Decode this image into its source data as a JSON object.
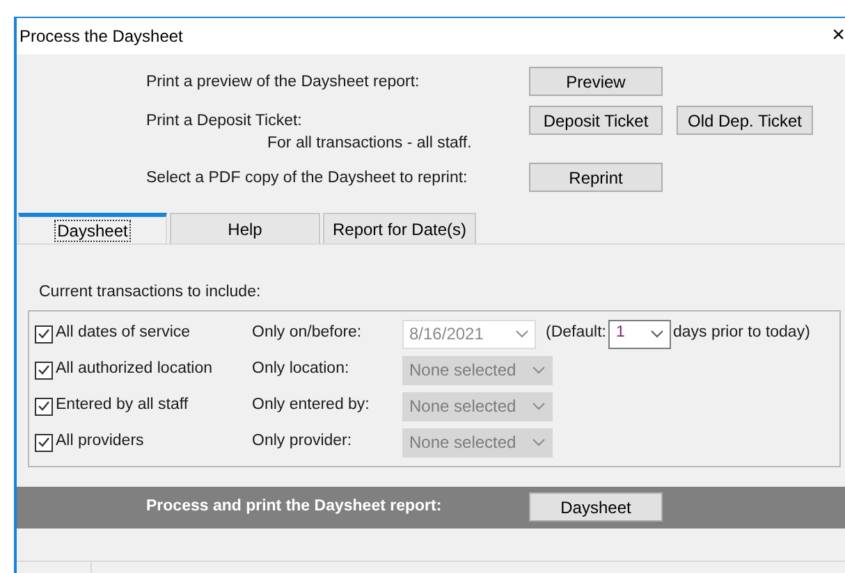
{
  "window": {
    "title": "Process the Daysheet",
    "close": "×"
  },
  "actions": [
    {
      "label": "Print a preview of the Daysheet report:",
      "buttons": [
        "Preview"
      ]
    },
    {
      "label": "Print a Deposit Ticket:",
      "sublabel": "For all transactions - all staff.",
      "buttons": [
        "Deposit Ticket",
        "Old Dep. Ticket"
      ]
    },
    {
      "label": "Select a PDF copy of the Daysheet to reprint:",
      "buttons": [
        "Reprint"
      ]
    }
  ],
  "tabs": [
    {
      "label": "Daysheet",
      "selected": true
    },
    {
      "label": "Help",
      "selected": false
    },
    {
      "label": "Report for Date(s)",
      "selected": false
    }
  ],
  "group": {
    "title": "Current transactions to include:",
    "rows": [
      {
        "checkbox": "All dates of service",
        "checked": true,
        "filter_label": "Only on/before:",
        "field": {
          "value": "8/16/2021",
          "disabled": true,
          "kind": "date"
        },
        "default": {
          "prefix": "(Default:",
          "value": "1",
          "suffix": "days prior to today)"
        }
      },
      {
        "checkbox": "All authorized location",
        "checked": true,
        "filter_label": "Only location:",
        "field": {
          "value": "None selected",
          "disabled": true,
          "kind": "select"
        }
      },
      {
        "checkbox": "Entered by all staff",
        "checked": true,
        "filter_label": "Only entered by:",
        "field": {
          "value": "None selected",
          "disabled": true,
          "kind": "select"
        }
      },
      {
        "checkbox": "All providers",
        "checked": true,
        "filter_label": "Only provider:",
        "field": {
          "value": "None selected",
          "disabled": true,
          "kind": "select"
        }
      }
    ]
  },
  "process_bar": {
    "label": "Process and print the Daysheet report:",
    "button": "Daysheet"
  }
}
